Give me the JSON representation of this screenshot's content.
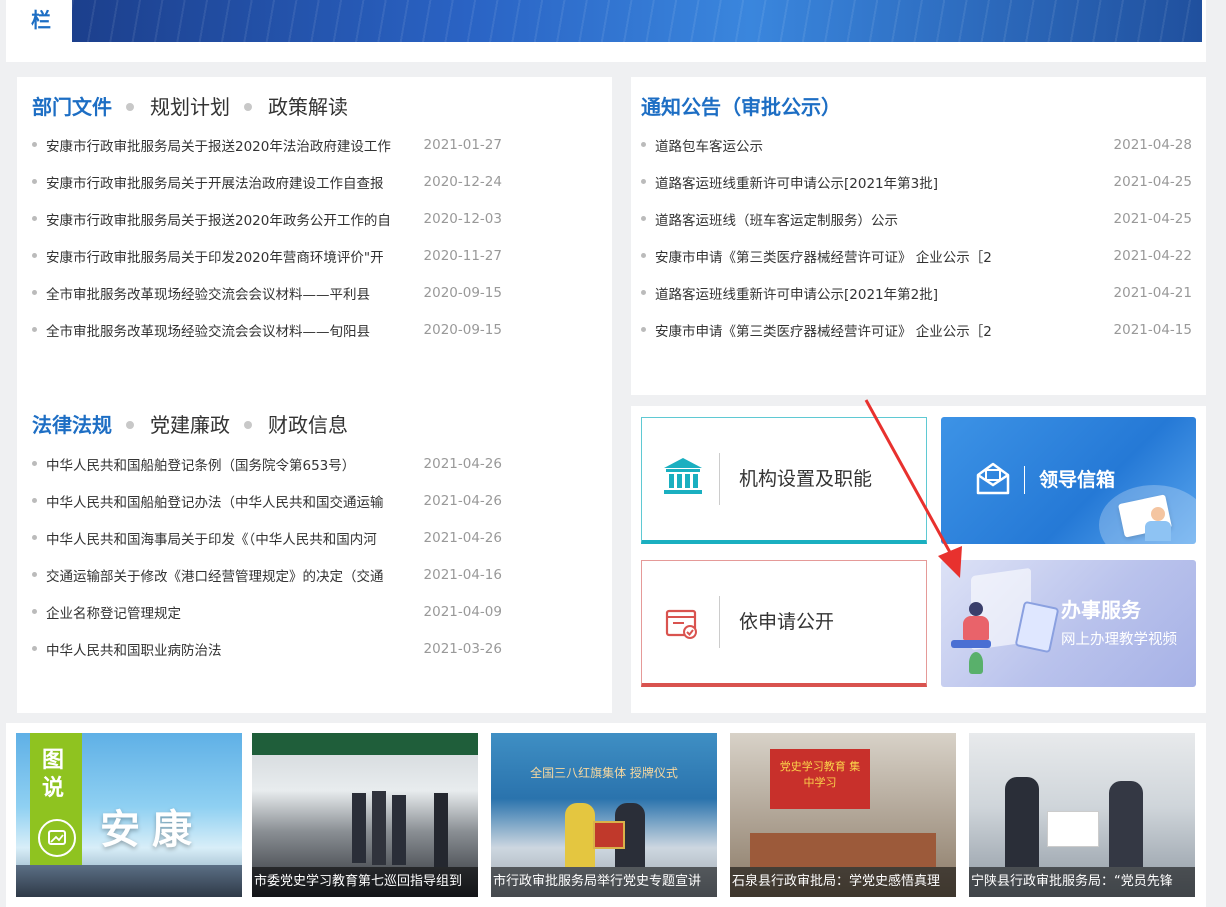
{
  "top": {
    "label": "栏"
  },
  "dept_card": {
    "tabs": [
      {
        "label": "部门文件"
      },
      {
        "label": "规划计划"
      },
      {
        "label": "政策解读"
      }
    ],
    "items": [
      {
        "title": "安康市行政审批服务局关于报送2020年法治政府建设工作",
        "date": "2021-01-27"
      },
      {
        "title": "安康市行政审批服务局关于开展法治政府建设工作自查报",
        "date": "2020-12-24"
      },
      {
        "title": "安康市行政审批服务局关于报送2020年政务公开工作的自",
        "date": "2020-12-03"
      },
      {
        "title": "安康市行政审批服务局关于印发2020年营商环境评价\"开",
        "date": "2020-11-27"
      },
      {
        "title": "全市审批服务改革现场经验交流会会议材料——平利县",
        "date": "2020-09-15"
      },
      {
        "title": "全市审批服务改革现场经验交流会会议材料——旬阳县",
        "date": "2020-09-15"
      }
    ]
  },
  "notice_card": {
    "title": "通知公告（审批公示）",
    "items": [
      {
        "title": "道路包车客运公示",
        "date": "2021-04-28"
      },
      {
        "title": "道路客运班线重新许可申请公示[2021年第3批]",
        "date": "2021-04-25"
      },
      {
        "title": "道路客运班线（班车客运定制服务）公示",
        "date": "2021-04-25"
      },
      {
        "title": "安康市申请《第三类医疗器械经营许可证》 企业公示［2",
        "date": "2021-04-22"
      },
      {
        "title": "道路客运班线重新许可申请公示[2021年第2批]",
        "date": "2021-04-21"
      },
      {
        "title": "安康市申请《第三类医疗器械经营许可证》 企业公示［2",
        "date": "2021-04-15"
      }
    ]
  },
  "law_card": {
    "tabs": [
      {
        "label": "法律法规"
      },
      {
        "label": "党建廉政"
      },
      {
        "label": "财政信息"
      }
    ],
    "items": [
      {
        "title": "中华人民共和国船舶登记条例（国务院令第653号）",
        "date": "2021-04-26"
      },
      {
        "title": "中华人民共和国船舶登记办法（中华人民共和国交通运输",
        "date": "2021-04-26"
      },
      {
        "title": "中华人民共和国海事局关于印发《（中华人民共和国内河",
        "date": "2021-04-26"
      },
      {
        "title": "交通运输部关于修改《港口经营管理规定》的决定（交通",
        "date": "2021-04-16"
      },
      {
        "title": "企业名称登记管理规定",
        "date": "2021-04-09"
      },
      {
        "title": "中华人民共和国职业病防治法",
        "date": "2021-03-26"
      }
    ]
  },
  "tiles": {
    "org": {
      "label": "机构设置及职能",
      "icon": "bank-icon",
      "color": "#1aafc0"
    },
    "leader_mail": {
      "label": "领导信箱",
      "icon": "mail-icon"
    },
    "apply_open": {
      "label": "依申请公开",
      "icon": "document-check-icon",
      "color": "#d9534f"
    },
    "service": {
      "title": "办事服务",
      "subtitle": "网上办理教学视频"
    }
  },
  "photos": {
    "badge": {
      "line1": "图",
      "line2": "说",
      "city": "安康"
    },
    "items": [
      {
        "caption": "市委党史学习教育第七巡回指导组到"
      },
      {
        "caption": "市行政审批服务局举行党史专题宣讲"
      },
      {
        "caption": "石泉县行政审批局：学党史感悟真理"
      },
      {
        "caption": "宁陕县行政审批服务局：“党员先锋"
      }
    ],
    "photo2_banner": "全国三八红旗集体 授牌仪式",
    "photo3_banner": "党史学习教育 集中学习"
  },
  "colors": {
    "accent": "#1d6ec4",
    "background": "#eff0f2"
  }
}
